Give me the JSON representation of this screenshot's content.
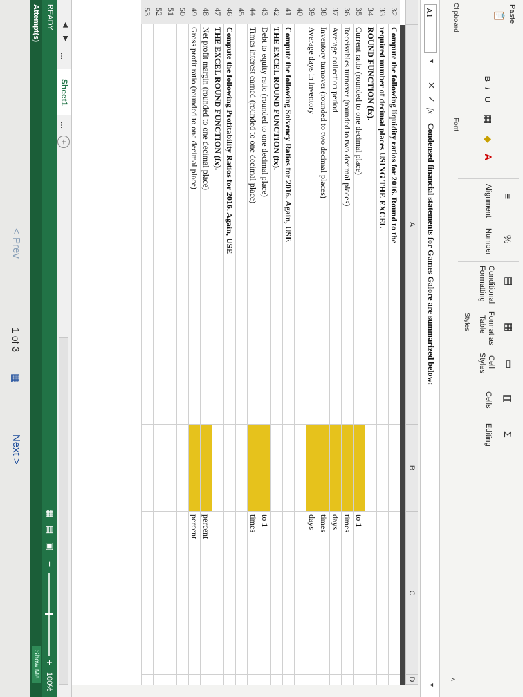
{
  "ribbon": {
    "paste_label": "Paste",
    "clipboard_label": "Clipboard",
    "font_label": "Font",
    "font_buttons": [
      "B",
      "I",
      "U"
    ],
    "alignment_label": "Alignment",
    "number_label": "Number",
    "conditional_label": "Conditional",
    "formatting_label": "Formatting",
    "format_as_label": "Format as",
    "table_label": "Table",
    "cell_label": "Cell",
    "styles_btn_label": "Styles",
    "styles_group_label": "Styles",
    "cells_label": "Cells",
    "editing_label": "Editing"
  },
  "formula_bar": {
    "name_box": "A1",
    "fx": "fx",
    "content": "Condensed financial statements for Games Galore are summarized below:"
  },
  "columns": [
    "A",
    "B",
    "C",
    "D"
  ],
  "rows": [
    {
      "num": "32",
      "a": "Compute the following liquidity ratios for 2016. Round to the",
      "bold": true,
      "yellow": false,
      "c": ""
    },
    {
      "num": "33",
      "a": "required number of decimal places USING THE EXCEL",
      "bold": true,
      "yellow": false,
      "c": ""
    },
    {
      "num": "34",
      "a": "ROUND FUNCTION (fx).",
      "bold": true,
      "yellow": false,
      "c": ""
    },
    {
      "num": "35",
      "a": "Current ratio (rounded to one decimal place)",
      "bold": false,
      "yellow": true,
      "c": "to 1"
    },
    {
      "num": "36",
      "a": "Receivables turnover (rounded to two decimal places)",
      "bold": false,
      "yellow": true,
      "c": "times"
    },
    {
      "num": "37",
      "a": "Average collection period",
      "bold": false,
      "yellow": true,
      "c": "days"
    },
    {
      "num": "38",
      "a": "Inventory turnover (rounded to two decimal places)",
      "bold": false,
      "yellow": true,
      "c": "times"
    },
    {
      "num": "39",
      "a": "Average days in inventory",
      "bold": false,
      "yellow": true,
      "c": "days"
    },
    {
      "num": "40",
      "a": "",
      "bold": false,
      "yellow": false,
      "c": ""
    },
    {
      "num": "41",
      "a": "Compute the following Solvency Ratios for 2016. Again, USE",
      "bold": true,
      "yellow": false,
      "c": ""
    },
    {
      "num": "42",
      "a": "THE EXCEL ROUND FUNCTION (fx).",
      "bold": true,
      "yellow": false,
      "c": ""
    },
    {
      "num": "43",
      "a": "Debt to equity ratio (rounded to one decimal place)",
      "bold": false,
      "yellow": true,
      "c": "to 1"
    },
    {
      "num": "44",
      "a": "Times interest earned (rounded to one decimal place)",
      "bold": false,
      "yellow": true,
      "c": "times"
    },
    {
      "num": "45",
      "a": "",
      "bold": false,
      "yellow": false,
      "c": ""
    },
    {
      "num": "46",
      "a": "Compute the following Profitability Ratios for 2016. Again, USE",
      "bold": true,
      "yellow": false,
      "c": ""
    },
    {
      "num": "47",
      "a": "THE EXCEL ROUND FUNCTION (fx).",
      "bold": true,
      "yellow": false,
      "c": ""
    },
    {
      "num": "48",
      "a": "Net profit margin (rounded to one decimal place)",
      "bold": false,
      "yellow": true,
      "c": "percent"
    },
    {
      "num": "49",
      "a": "Gross profit ratio (rounded to one decimal place)",
      "bold": false,
      "yellow": true,
      "c": "percent"
    },
    {
      "num": "50",
      "a": "",
      "bold": false,
      "yellow": false,
      "c": ""
    },
    {
      "num": "51",
      "a": "",
      "bold": false,
      "yellow": false,
      "c": ""
    },
    {
      "num": "52",
      "a": "",
      "bold": false,
      "yellow": false,
      "c": ""
    },
    {
      "num": "53",
      "a": "",
      "bold": false,
      "yellow": false,
      "c": ""
    }
  ],
  "sheet_tabs": {
    "active": "Sheet1",
    "more": "...",
    "add": "+"
  },
  "status": {
    "ready": "READY",
    "attempts": "Attempt(s)",
    "zoom": "100%",
    "show_me": "Show Me"
  },
  "pager": {
    "prev": "Prev",
    "page": "1",
    "of_label": "of 3",
    "next": "Next"
  },
  "colors": {
    "highlight": "#e6c21c",
    "status_bar": "#217346"
  }
}
